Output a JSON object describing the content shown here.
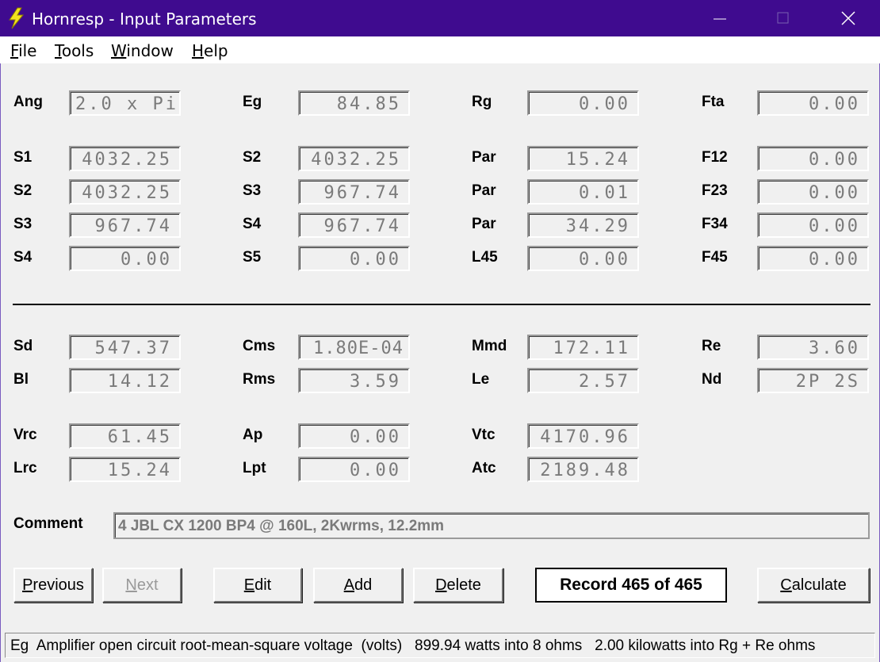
{
  "window": {
    "title": "Hornresp - Input Parameters"
  },
  "menu": [
    {
      "label": "File",
      "mnemonic": "F",
      "rest": "ile"
    },
    {
      "label": "Tools",
      "mnemonic": "T",
      "rest": "ools"
    },
    {
      "label": "Window",
      "mnemonic": "W",
      "rest": "indow"
    },
    {
      "label": "Help",
      "mnemonic": "H",
      "rest": "elp"
    }
  ],
  "fields": {
    "Ang": "2.0 x Pi",
    "Eg": "84.85",
    "Rg": "0.00",
    "Fta": "0.00",
    "S1_r1": "4032.25",
    "S2_r1": "4032.25",
    "Par_r1": "15.24",
    "F12": "0.00",
    "S2_r2": "4032.25",
    "S3_r2": "967.74",
    "Par_r2": "0.01",
    "F23": "0.00",
    "S3_r3": "967.74",
    "S4_r3": "967.74",
    "Par_r3": "34.29",
    "F34": "0.00",
    "S4_r4": "0.00",
    "S5_r4": "0.00",
    "L45": "0.00",
    "F45": "0.00",
    "Sd": "547.37",
    "Cms": "1.80E-04",
    "Mmd": "172.11",
    "Re": "3.60",
    "Bl": "14.12",
    "Rms": "3.59",
    "Le": "2.57",
    "Nd": "2P 2S",
    "Vrc": "61.45",
    "Ap": "0.00",
    "Vtc": "4170.96",
    "Lrc": "15.24",
    "Lpt": "0.00",
    "Atc": "2189.48"
  },
  "labels": {
    "Ang": "Ang",
    "Eg": "Eg",
    "Rg": "Rg",
    "Fta": "Fta",
    "S1": "S1",
    "S2": "S2",
    "S3": "S3",
    "S4": "S4",
    "S5": "S5",
    "Par": "Par",
    "L45": "L45",
    "F12": "F12",
    "F23": "F23",
    "F34": "F34",
    "F45": "F45",
    "Sd": "Sd",
    "Cms": "Cms",
    "Mmd": "Mmd",
    "Re": "Re",
    "Bl": "Bl",
    "Rms": "Rms",
    "Le": "Le",
    "Nd": "Nd",
    "Vrc": "Vrc",
    "Ap": "Ap",
    "Vtc": "Vtc",
    "Lrc": "Lrc",
    "Lpt": "Lpt",
    "Atc": "Atc",
    "Comment": "Comment"
  },
  "comment": "4 JBL CX 1200 BP4 @ 160L, 2Kwrms, 12.2mm",
  "buttons": {
    "previous": {
      "mnemonic": "P",
      "rest": "revious"
    },
    "next": {
      "mnemonic": "N",
      "rest": "ext"
    },
    "edit": {
      "mnemonic": "E",
      "rest": "dit"
    },
    "add": {
      "mnemonic": "A",
      "rest": "dd"
    },
    "delete": {
      "mnemonic": "D",
      "rest": "elete"
    },
    "calculate": {
      "mnemonic": "C",
      "rest": "alculate"
    }
  },
  "record": "Record 465 of 465",
  "status": "Eg  Amplifier open circuit root-mean-square voltage  (volts)   899.94 watts into 8 ohms   2.00 kilowatts into Rg + Re ohms"
}
